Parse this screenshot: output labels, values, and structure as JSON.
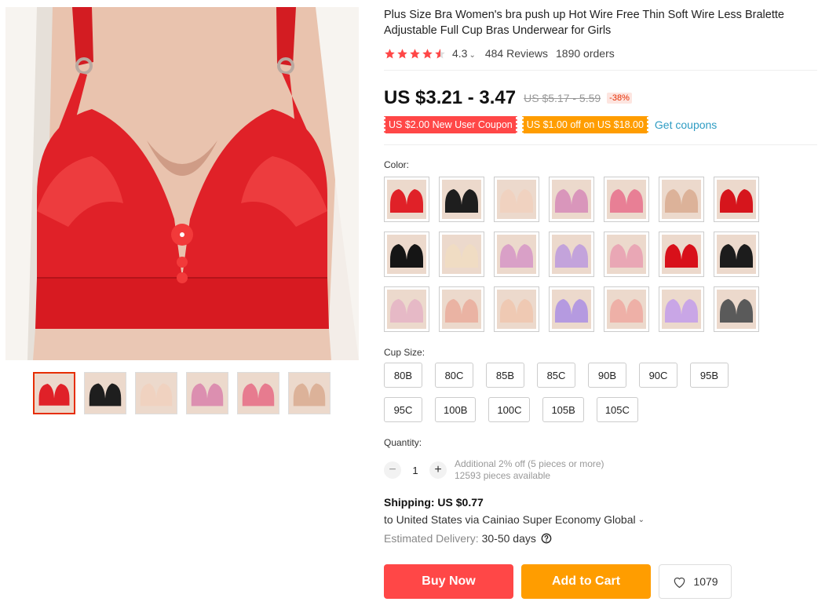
{
  "product": {
    "title": "Plus Size Bra Women's bra push up Hot Wire Free Thin Soft Wire Less Bralette Adjustable Full Cup Bras Underwear for Girls",
    "main_image_color": "#e8242b"
  },
  "rating": {
    "stars": 4.3,
    "value": "4.3",
    "reviews": "484 Reviews",
    "orders": "1890 orders"
  },
  "price": {
    "current": "US $3.21 - 3.47",
    "original": "US $5.17 - 5.59",
    "discount": "-38%"
  },
  "coupons": {
    "new_user": "US $2.00 New User Coupon",
    "store": "US $1.00 off on US $18.00",
    "get_label": "Get coupons"
  },
  "thumbnails": [
    {
      "icon": "red-bra-thumbnail",
      "color": "#e02128"
    },
    {
      "icon": "black-bra-thumbnail",
      "color": "#1e1e1e"
    },
    {
      "icon": "beige-bra-thumbnail",
      "color": "#f0d2c0"
    },
    {
      "icon": "pink-bra-thumbnail",
      "color": "#dc8fb0"
    },
    {
      "icon": "rose-bra-thumbnail",
      "color": "#e77b8f"
    },
    {
      "icon": "nude-bra-thumbnail",
      "color": "#dcb299"
    }
  ],
  "color": {
    "label": "Color:",
    "swatches": [
      "#e02128",
      "#1e1e1e",
      "#f0d2c0",
      "#d996bb",
      "#e87f95",
      "#dcb299",
      "#d6151c",
      "#151515",
      "#f0dcc3",
      "#d9a0c7",
      "#c3a3db",
      "#e9a7b5",
      "#d8101a",
      "#1c1c1c",
      "#e6b9c6",
      "#eab3a3",
      "#efc9b3",
      "#b59ae0",
      "#eeb0a7",
      "#c9a6e6",
      "#5a5a5a"
    ]
  },
  "cup_size": {
    "label": "Cup Size:",
    "options": [
      "80B",
      "80C",
      "85B",
      "85C",
      "90B",
      "90C",
      "95B",
      "95C",
      "100B",
      "100C",
      "105B",
      "105C"
    ]
  },
  "quantity": {
    "label": "Quantity:",
    "value": "1",
    "minus": "−",
    "plus": "+",
    "note": "Additional 2% off (5 pieces or more)",
    "available": "12593 pieces available"
  },
  "shipping": {
    "title": "Shipping: US $0.77",
    "route": "to United States via Cainiao Super Economy Global",
    "delivery_label": "Estimated Delivery:",
    "delivery_days": "30-50 days"
  },
  "actions": {
    "buy_now": "Buy Now",
    "add_to_cart": "Add to Cart",
    "wishlist_count": "1079"
  },
  "colors": {
    "accent_red": "#ff4747",
    "accent_orange": "#ff9d00",
    "link_blue": "#2e9cc3",
    "star": "#ff4747"
  }
}
